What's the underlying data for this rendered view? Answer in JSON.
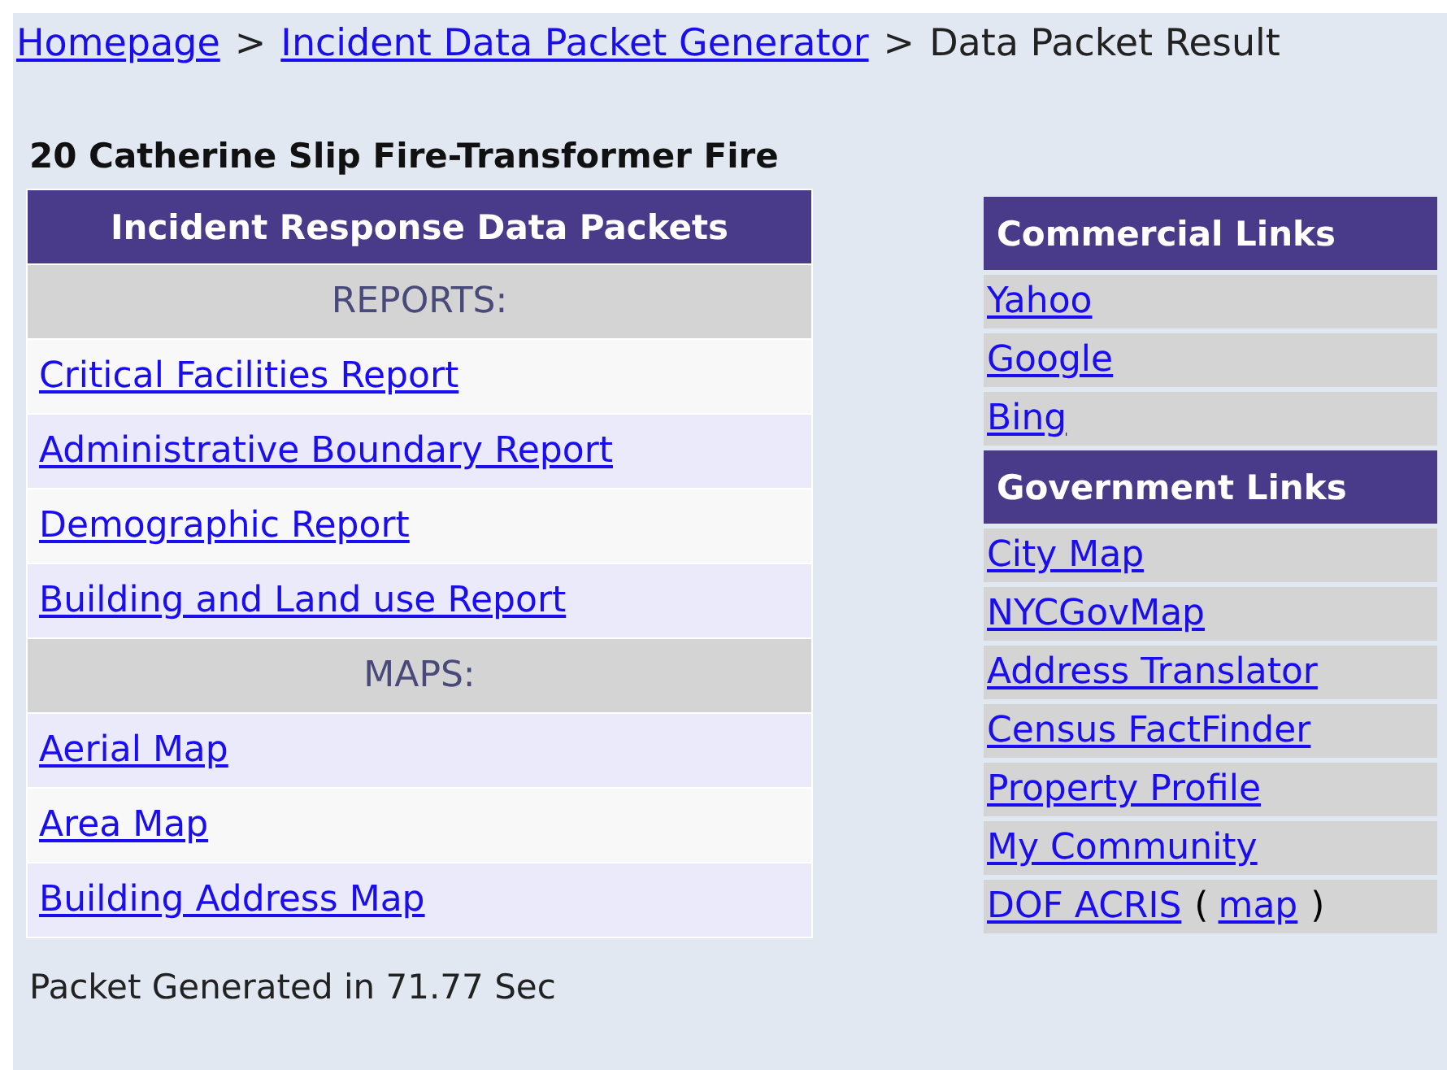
{
  "breadcrumb": {
    "links": [
      "Homepage",
      "Incident Data Packet Generator"
    ],
    "separator": ">",
    "current": "Data Packet Result"
  },
  "incident_title": "20 Catherine Slip Fire-Transformer Fire",
  "packets": {
    "title": "Incident Response Data Packets",
    "rows": [
      {
        "kind": "section",
        "label": "REPORTS:"
      },
      {
        "kind": "link",
        "label": "Critical Facilities Report"
      },
      {
        "kind": "link",
        "label": "Administrative Boundary Report"
      },
      {
        "kind": "link",
        "label": "Demographic Report"
      },
      {
        "kind": "link",
        "label": "Building and Land use Report"
      },
      {
        "kind": "section",
        "label": "MAPS:"
      },
      {
        "kind": "link",
        "label": "Aerial Map"
      },
      {
        "kind": "link",
        "label": "Area Map"
      },
      {
        "kind": "link",
        "label": "Building Address Map"
      }
    ]
  },
  "link_groups": [
    {
      "title": "Commercial Links",
      "items": [
        {
          "label": "Yahoo"
        },
        {
          "label": "Google"
        },
        {
          "label": "Bing"
        }
      ]
    },
    {
      "title": "Government Links",
      "items": [
        {
          "label": "City Map"
        },
        {
          "label": "NYCGovMap"
        },
        {
          "label": "Address Translator"
        },
        {
          "label": "Census FactFinder"
        },
        {
          "label": "Property Profile"
        },
        {
          "label": "My Community"
        },
        {
          "label": "DOF ACRIS",
          "extra": {
            "open": "(",
            "link": "map",
            "close": ")"
          }
        }
      ]
    }
  ],
  "footer": "Packet Generated in 71.77 Sec"
}
